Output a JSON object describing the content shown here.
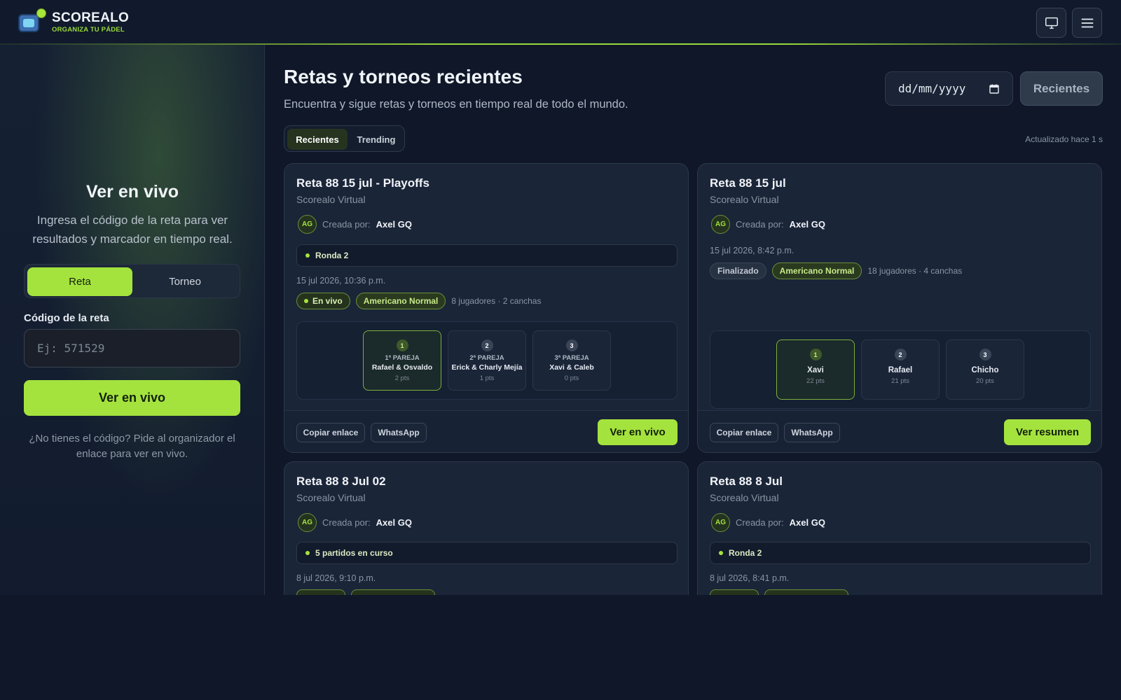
{
  "header": {
    "logo_title": "SCOREALO",
    "logo_subtitle": "ORGANIZA TU PÁDEL",
    "icons": [
      "monitor-icon",
      "menu-icon"
    ]
  },
  "sidebar": {
    "title": "Ver en vivo",
    "description": "Ingresa el código de la reta para ver resultados y marcador en tiempo real.",
    "toggle": {
      "options": [
        "Reta",
        "Torneo"
      ],
      "selected": "Reta"
    },
    "code_label": "Código de la reta",
    "code_placeholder": "Ej: 571529",
    "cta": "Ver en vivo",
    "help": "¿No tienes el código? Pide al organizador el enlace para ver en vivo."
  },
  "main": {
    "title": "Retas y torneos recientes",
    "subtitle": "Encuentra y sigue retas y torneos en tiempo real de todo el mundo.",
    "date_placeholder": "dd/mm/yyyy",
    "recent_button": "Recientes",
    "tabs": [
      {
        "label": "Recientes",
        "active": true
      },
      {
        "label": "Trending",
        "active": false
      }
    ],
    "updated": "Actualizado hace 1 s"
  },
  "cards": [
    {
      "title": "Reta 88 15 jul - Playoffs",
      "venue": "Scorealo Virtual",
      "avatar": "AG",
      "created_by_label": "Creada por:",
      "creator": "Axel GQ",
      "round": "Ronda 2",
      "date": "15 jul 2026, 10:36 p.m.",
      "status": "En vivo",
      "mode": "Americano Normal",
      "meta": "8 jugadores · 2 canchas",
      "podium": [
        {
          "pos": "1",
          "rank": "1ª PAREJA",
          "name": "Rafael & Osvaldo",
          "pts": "2 pts"
        },
        {
          "pos": "2",
          "rank": "2ª PAREJA",
          "name": "Erick & Charly Mejía",
          "pts": "1 pts"
        },
        {
          "pos": "3",
          "rank": "3ª PAREJA",
          "name": "Xavi & Caleb",
          "pts": "0 pts"
        }
      ],
      "copy_link": "Copiar enlace",
      "whatsapp": "WhatsApp",
      "cta": "Ver en vivo"
    },
    {
      "title": "Reta 88 15 jul",
      "venue": "Scorealo Virtual",
      "avatar": "AG",
      "created_by_label": "Creada por:",
      "creator": "Axel GQ",
      "date": "15 jul 2026, 8:42 p.m.",
      "status": "Finalizado",
      "mode": "Americano Normal",
      "meta": "18 jugadores · 4 canchas",
      "podium": [
        {
          "pos": "1",
          "name": "Xavi",
          "pts": "22 pts"
        },
        {
          "pos": "2",
          "name": "Rafael",
          "pts": "21 pts"
        },
        {
          "pos": "3",
          "name": "Chicho",
          "pts": "20 pts"
        }
      ],
      "copy_link": "Copiar enlace",
      "whatsapp": "WhatsApp",
      "cta": "Ver resumen"
    },
    {
      "title": "Reta 88 8 Jul 02",
      "venue": "Scorealo Virtual",
      "avatar": "AG",
      "created_by_label": "Creada por:",
      "creator": "Axel GQ",
      "round": "5 partidos en curso",
      "date": "8 jul 2026, 9:10 p.m."
    },
    {
      "title": "Reta 88 8 Jul",
      "venue": "Scorealo Virtual",
      "avatar": "AG",
      "created_by_label": "Creada por:",
      "creator": "Axel GQ",
      "round": "Ronda 2",
      "date": "8 jul 2026, 8:41 p.m."
    }
  ],
  "colors": {
    "accent": "#a4e33e",
    "background": "#0f1729",
    "card": "#1a2538"
  }
}
